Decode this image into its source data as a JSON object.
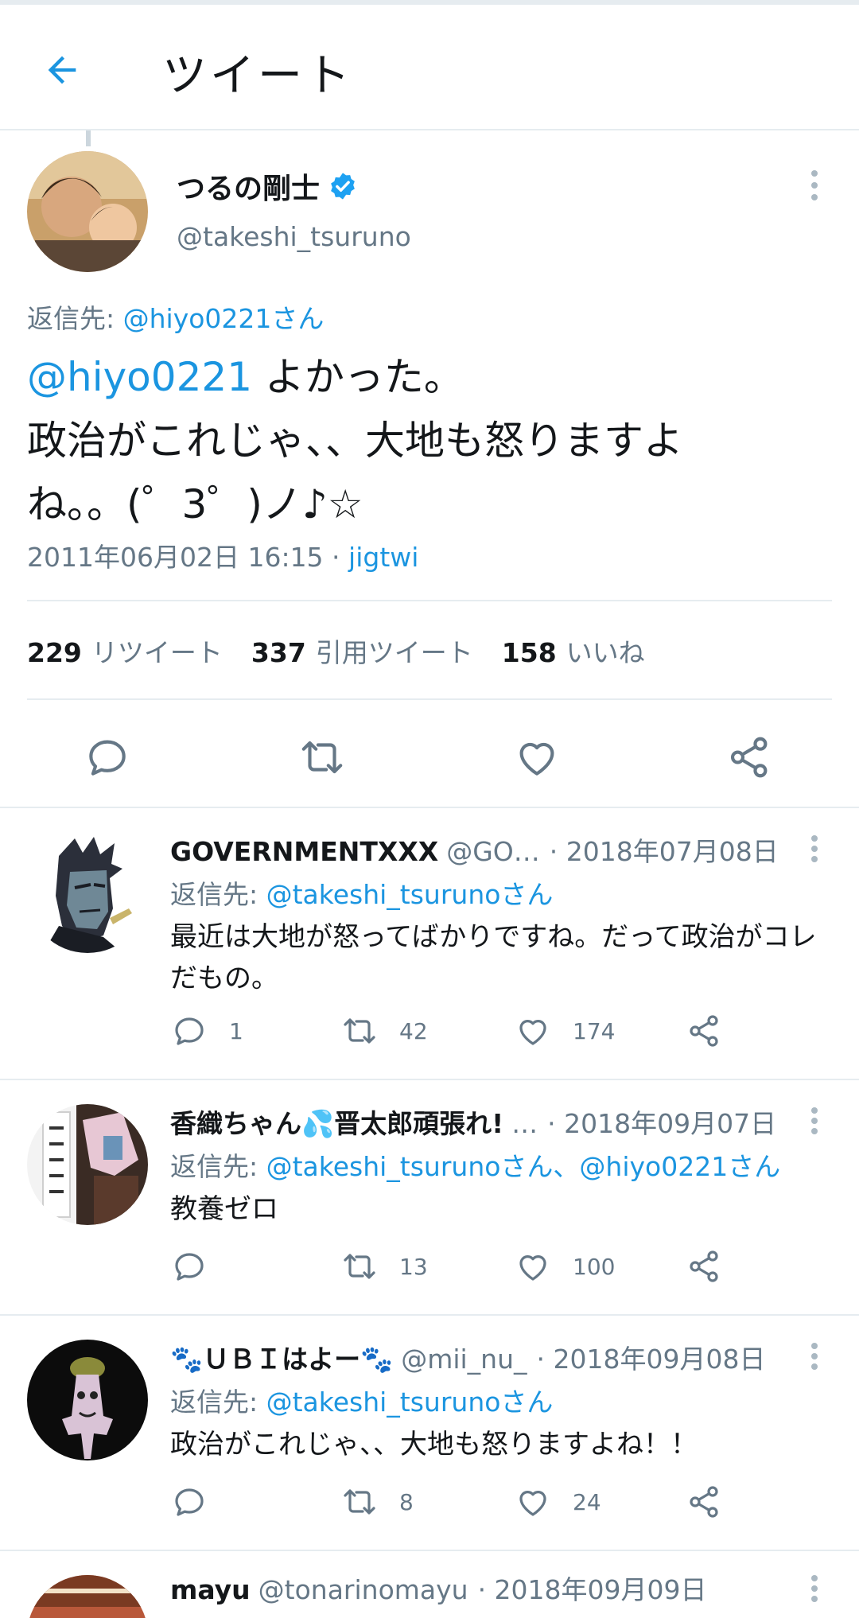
{
  "header": {
    "title": "ツイート"
  },
  "tweet": {
    "author_name": "つるの剛士",
    "author_handle": "@takeshi_tsuruno",
    "reply_to_prefix": "返信先: ",
    "reply_to_link": "@hiyo0221さん",
    "text_mention": "@hiyo0221",
    "text_body": " よかった。\n政治がこれじゃ、、大地も怒りますよ\nね。。(゜3゜)ノ♪☆",
    "timestamp": "2011年06月02日 16:15 · ",
    "source": "jigtwi",
    "stats": {
      "retweets_count": "229",
      "retweets_label": "リツイート",
      "quotes_count": "337",
      "quotes_label": "引用ツイート",
      "likes_count": "158",
      "likes_label": "いいね"
    }
  },
  "replies": [
    {
      "name": "GOVERNMENTXXX",
      "handle": "@GO…",
      "date": "· 2018年07月08日",
      "reply_to_prefix": "返信先: ",
      "reply_to": "@takeshi_tsurunoさん",
      "text": "最近は大地が怒ってばかりですね。だって政治がコレだもの。",
      "reply_count": "1",
      "retweet_count": "42",
      "like_count": "174"
    },
    {
      "name": "香織ちゃん💦晋太郎頑張れ!",
      "handle": "…",
      "date": "· 2018年09月07日",
      "reply_to_prefix": "返信先: ",
      "reply_to": "@takeshi_tsurunoさん、@hiyo0221さん",
      "text": "教養ゼロ",
      "reply_count": "",
      "retweet_count": "13",
      "like_count": "100"
    },
    {
      "name": "🐾ＵＢＩはよー🐾",
      "handle": "@mii_nu_",
      "date": "· 2018年09月08日",
      "reply_to_prefix": "返信先: ",
      "reply_to": "@takeshi_tsurunoさん",
      "text": "政治がこれじゃ、、大地も怒りますよね！！",
      "reply_count": "",
      "retweet_count": "8",
      "like_count": "24"
    },
    {
      "name": "mayu",
      "handle": "@tonarinomayu",
      "date": "· 2018年09月09日"
    }
  ],
  "colors": {
    "accent": "#1b95e0",
    "secondary_text": "#657786",
    "divider": "#e6ecf0"
  },
  "icons": [
    "back-arrow-icon",
    "verified-badge-icon",
    "more-icon",
    "reply-icon",
    "retweet-icon",
    "like-icon",
    "share-icon"
  ]
}
